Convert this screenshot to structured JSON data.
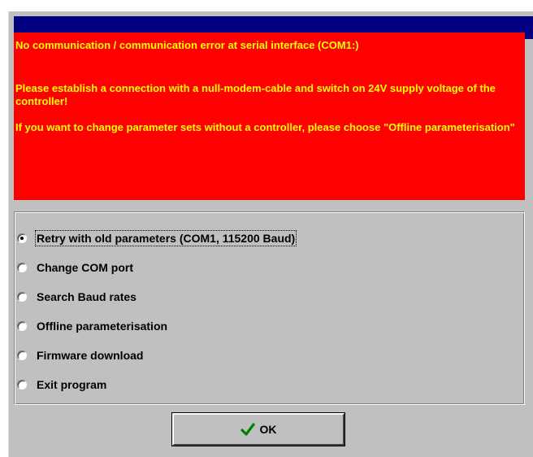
{
  "error": {
    "line1": "No communication / communication error at serial interface (COM1:)",
    "line2": "Please establish a connection with a null-modem-cable and switch on 24V supply voltage of the controller!",
    "line3": "If you want to change parameter sets without a controller, please choose \"Offline parameterisation\""
  },
  "options": [
    {
      "label": "Retry with old parameters (COM1, 115200 Baud)",
      "checked": true
    },
    {
      "label": "Change COM port",
      "checked": false
    },
    {
      "label": "Search Baud rates",
      "checked": false
    },
    {
      "label": "Offline parameterisation",
      "checked": false
    },
    {
      "label": "Firmware download",
      "checked": false
    },
    {
      "label": "Exit program",
      "checked": false
    }
  ],
  "ok_button": {
    "label": "OK",
    "icon": "checkmark-icon"
  },
  "colors": {
    "titlebar": "#000080",
    "error_background": "#ff0000",
    "error_text": "#ffff00",
    "dialog_background": "#c0c0c0",
    "checkmark": "#008000"
  }
}
